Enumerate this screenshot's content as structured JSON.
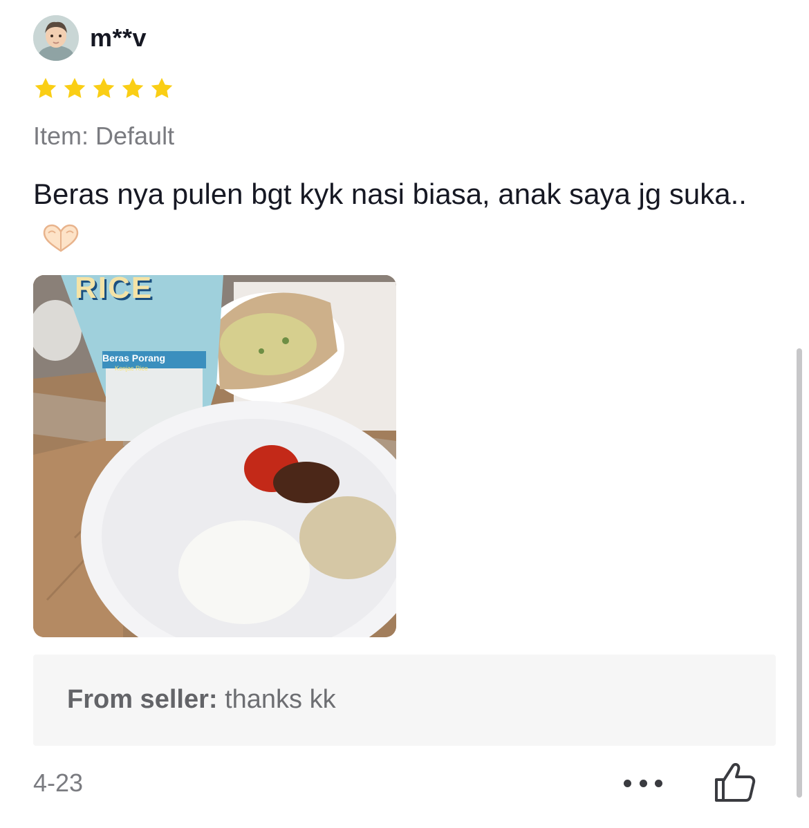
{
  "review": {
    "username": "m**v",
    "rating": 5,
    "rating_max": 5,
    "variant": "Item: Default",
    "text": "Beras nya pulen bgt kyk nasi biasa, anak saya jg suka..",
    "emoji_icon": "heart-hands-icon",
    "date": "4-23"
  },
  "photo": {
    "package_brand": "RICE",
    "package_product": "Beras Porang",
    "package_sub": "Konjac Rice"
  },
  "seller_reply": {
    "label": "From seller:",
    "text": "thanks kk"
  },
  "actions": {
    "more_icon": "more-dots-icon",
    "like_icon": "thumbs-up-icon"
  },
  "colors": {
    "star": "#FACE15",
    "reply_bg": "#F6F6F6",
    "muted_text": "#7A7B80"
  }
}
